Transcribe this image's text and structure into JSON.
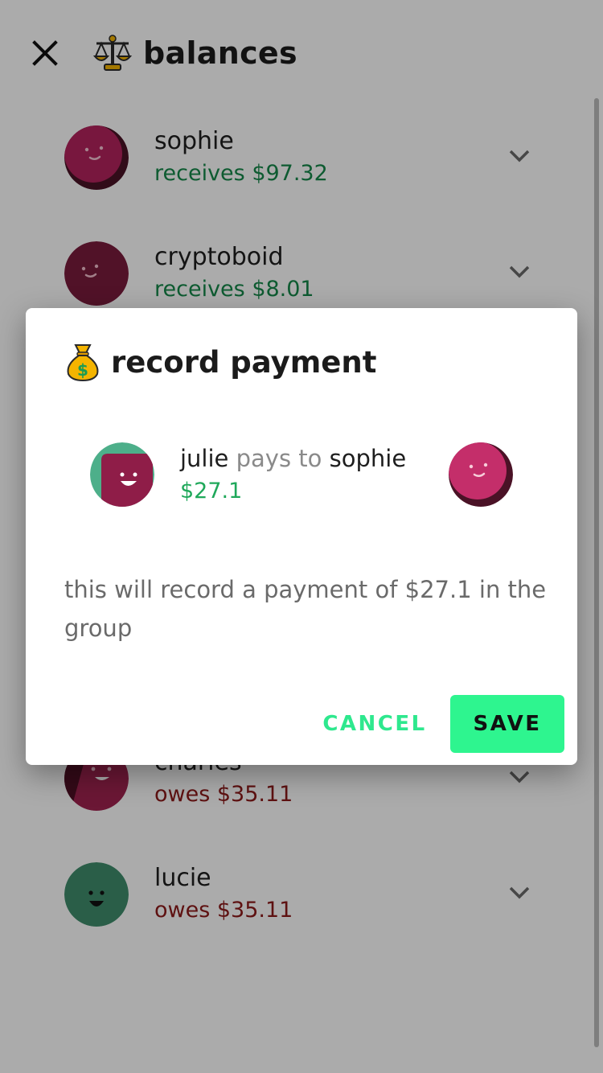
{
  "app_bar": {
    "title": "balances",
    "close_icon": "close-icon",
    "title_icon": "balance-scale-icon"
  },
  "balances": [
    {
      "name": "sophie",
      "status": "receives $97.32",
      "kind": "receives",
      "avatar": "pink-dot-smile"
    },
    {
      "name": "cryptoboid",
      "status": "receives $8.01",
      "kind": "receives",
      "avatar": "maroon-dot-smile"
    },
    {
      "name": "charles",
      "status": "owes $35.11",
      "kind": "owes",
      "avatar": "maroon-split-smile"
    },
    {
      "name": "lucie",
      "status": "owes $35.11",
      "kind": "owes",
      "avatar": "green-dot-smile"
    }
  ],
  "dialog": {
    "title": "record payment",
    "title_icon": "money-bag-icon",
    "payer": "julie",
    "verb": "pays to",
    "payee": "sophie",
    "amount": "$27.1",
    "description": "this will record a payment of $27.1 in the group",
    "cancel_label": "CANCEL",
    "save_label": "SAVE"
  },
  "colors": {
    "receives": "#16884a",
    "owes": "#8d1a1a",
    "accent": "#2ef58f",
    "accent_text": "#2ee88e",
    "pink_avatar": "#b4235d",
    "maroon_avatar": "#7a1b3c",
    "green_avatar": "#3f8d6c"
  }
}
